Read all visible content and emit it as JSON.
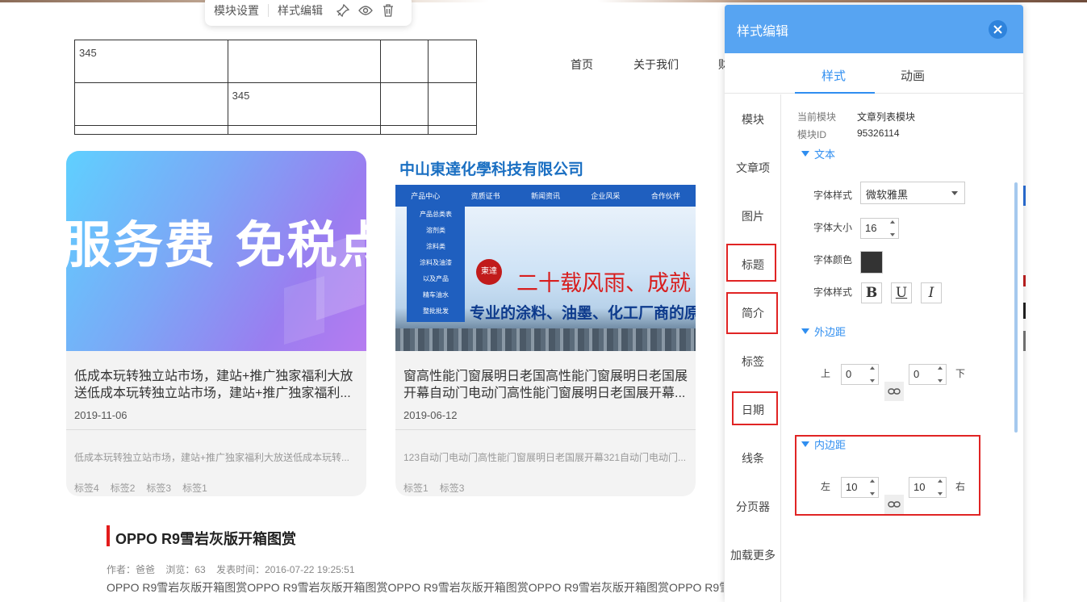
{
  "toolbar": {
    "module_settings": "模块设置",
    "style_edit": "样式编辑",
    "icons": [
      "pin-icon",
      "eye-icon",
      "trash-icon"
    ]
  },
  "table": {
    "rows": [
      [
        "345",
        "",
        "",
        ""
      ],
      [
        "",
        "345",
        "",
        ""
      ],
      [
        "",
        "",
        "",
        ""
      ]
    ]
  },
  "nav": {
    "items": [
      "首页",
      "关于我们",
      "财"
    ]
  },
  "cards": [
    {
      "image_text": "服务费 免税点",
      "title": "低成本玩转独立站市场，建站+推广独家福利大放送低成本玩转独立站市场，建站+推广独家福利...",
      "date": "2019-11-06",
      "summary": "低成本玩转独立站市场，建站+推广独家福利大放送低成本玩转...",
      "tags": [
        "标签4",
        "标签2",
        "标签3",
        "标签1"
      ]
    },
    {
      "company": "中山東達化學科技有限公司",
      "image_nav": [
        "产品中心",
        "资质证书",
        "新闻资讯",
        "企业风采",
        "合作伙伴"
      ],
      "image_dropdown": [
        "产品总类表",
        "溶剂类",
        "涂料类",
        "涂料及油漆",
        "以及产品",
        "精车油水",
        "整批批发"
      ],
      "image_logo": "東達",
      "image_slogan": "二十载风雨、成就",
      "image_sub": "专业的涂料、油墨、化工厂商的原",
      "title": "窗高性能门窗展明日老国高性能门窗展明日老国展开幕自动门电动门高性能门窗展明日老国展开幕...",
      "date": "2019-06-12",
      "summary": "123自动门电动门高性能门窗展明日老国展开幕321自动门电动门...",
      "tags": [
        "标签1",
        "标签3"
      ]
    }
  ],
  "article": {
    "title": "OPPO R9雪岩灰版开箱图赏",
    "author": "作者：爸爸",
    "views": "浏览：63",
    "published": "发表时间：2016-07-22 19:25:51",
    "body": "OPPO R9雪岩灰版开箱图赏OPPO R9雪岩灰版开箱图赏OPPO R9雪岩灰版开箱图赏OPPO R9雪岩灰版开箱图赏OPPO R9雪"
  },
  "panel": {
    "title": "样式编辑",
    "tabs": [
      "样式",
      "动画"
    ],
    "sidebar": [
      "模块",
      "文章项",
      "图片",
      "标题",
      "简介",
      "标签",
      "日期",
      "线条",
      "分页器",
      "加载更多"
    ],
    "current_module_label": "当前模块",
    "current_module_value": "文章列表模块",
    "module_id_label": "模块ID",
    "module_id_value": "95326114",
    "text_section": {
      "title": "文本",
      "font_family_label": "字体样式",
      "font_family_value": "微软雅黑",
      "font_size_label": "字体大小",
      "font_size_value": "16",
      "font_color_label": "字体颜色",
      "font_color": "#333333",
      "font_style_label": "字体样式",
      "bold": "B",
      "underline": "U",
      "italic": "I"
    },
    "margin_section": {
      "title": "外边距",
      "top_label": "上",
      "top_value": "0",
      "bottom_value": "0",
      "bottom_label": "下"
    },
    "padding_section": {
      "title": "内边距",
      "left_label": "左",
      "left_value": "10",
      "right_value": "10",
      "right_label": "右"
    }
  },
  "colors": {
    "accent": "#57a4f2",
    "highlight_box": "#e02424",
    "company_blue": "#1a6fc2",
    "article_bar": "#e31b1b"
  }
}
